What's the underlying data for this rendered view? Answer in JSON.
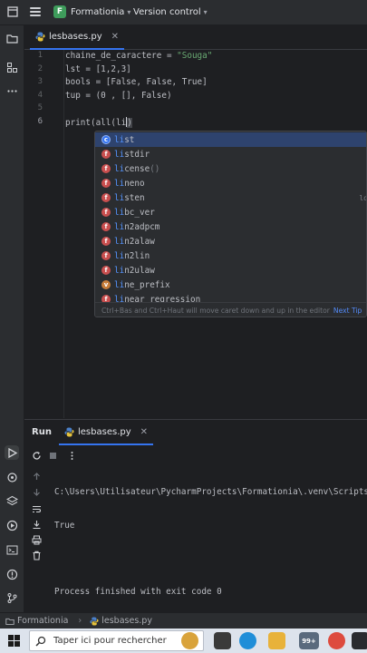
{
  "titlebar": {
    "project_initial": "F",
    "project_name": "Formationia",
    "vcs_label": "Version control"
  },
  "editor_tab": {
    "filename": "lesbases.py"
  },
  "editor": {
    "line_numbers": [
      "1",
      "2",
      "3",
      "4",
      "5",
      "6"
    ],
    "lines": [
      {
        "var": "chaine_de_caractere",
        "op": " = ",
        "str": "\"Souga\""
      },
      {
        "text": "lst = [1,2,3]"
      },
      {
        "text": "bools = [False, False, True]"
      },
      {
        "text": "tup = (0 , [], False)"
      },
      {
        "text": ""
      },
      {
        "before": "print(all(",
        "typed": "li",
        "after": ")"
      }
    ]
  },
  "completion": {
    "items": [
      {
        "kind": "c",
        "kind_letter": "c",
        "match": "li",
        "rest": "st",
        "suffix": "",
        "hint": ""
      },
      {
        "kind": "f",
        "kind_letter": "f",
        "match": "li",
        "rest": "stdir",
        "suffix": "",
        "hint": ""
      },
      {
        "kind": "f",
        "kind_letter": "f",
        "match": "li",
        "rest": "cense",
        "suffix": "()",
        "hint": ""
      },
      {
        "kind": "f",
        "kind_letter": "f",
        "match": "li",
        "rest": "neno",
        "suffix": "",
        "hint": ""
      },
      {
        "kind": "f",
        "kind_letter": "f",
        "match": "li",
        "rest": "sten",
        "suffix": "",
        "hint": "lo"
      },
      {
        "kind": "f",
        "kind_letter": "f",
        "match": "li",
        "rest": "bc_ver",
        "suffix": "",
        "hint": ""
      },
      {
        "kind": "f",
        "kind_letter": "f",
        "match": "li",
        "rest": "n2adpcm",
        "suffix": "",
        "hint": ""
      },
      {
        "kind": "f",
        "kind_letter": "f",
        "match": "li",
        "rest": "n2alaw",
        "suffix": "",
        "hint": ""
      },
      {
        "kind": "f",
        "kind_letter": "f",
        "match": "li",
        "rest": "n2lin",
        "suffix": "",
        "hint": ""
      },
      {
        "kind": "f",
        "kind_letter": "f",
        "match": "li",
        "rest": "n2ulaw",
        "suffix": "",
        "hint": ""
      },
      {
        "kind": "v",
        "kind_letter": "v",
        "match": "li",
        "rest": "ne_prefix",
        "suffix": "",
        "hint": ""
      },
      {
        "kind": "f",
        "kind_letter": "f",
        "match": "li",
        "rest": "near_regression",
        "suffix": "",
        "hint": ""
      }
    ],
    "footer_text": "Ctrl+Bas and Ctrl+Haut will move caret down and up in the editor",
    "next_tip": "Next Tip"
  },
  "run_panel": {
    "title": "Run",
    "tab_name": "lesbases.py",
    "output": [
      "C:\\Users\\Utilisateur\\PycharmProjects\\Formationia\\.venv\\Scripts\\python.exe",
      "True",
      "",
      "Process finished with exit code 0"
    ]
  },
  "statusbar": {
    "project": "Formationia",
    "file": "lesbases.py"
  },
  "taskbar": {
    "search_placeholder": "Taper ici pour rechercher",
    "badge": "99+"
  }
}
